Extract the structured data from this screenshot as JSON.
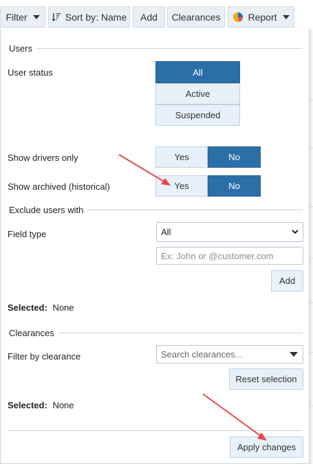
{
  "toolbar": {
    "filter": "Filter",
    "sort": "Sort by: Name",
    "add": "Add",
    "clearances": "Clearances",
    "report": "Report"
  },
  "users": {
    "legend": "Users",
    "status_label": "User status",
    "status_options": [
      "All",
      "Active",
      "Suspended"
    ],
    "status_selected": "All",
    "drivers_label": "Show drivers only",
    "drivers": {
      "yes": "Yes",
      "no": "No",
      "selected": "No"
    },
    "archived_label": "Show archived (historical)",
    "archived": {
      "yes": "Yes",
      "no": "No",
      "selected": "No"
    }
  },
  "exclude": {
    "legend": "Exclude users with",
    "field_type_label": "Field type",
    "field_type_value": "All",
    "value_placeholder": "Ex: John or @customer.com",
    "add_button": "Add",
    "selected_label": "Selected:",
    "selected_value": "None"
  },
  "clearances": {
    "legend": "Clearances",
    "filter_label": "Filter by clearance",
    "search_placeholder": "Search clearances...",
    "reset_button": "Reset selection",
    "selected_label": "Selected:",
    "selected_value": "None"
  },
  "footer": {
    "apply_button": "Apply changes"
  },
  "colors": {
    "accent": "#2b6fa8",
    "segment_off": "#e8f1fa",
    "annotation_arrow": "#e84646"
  }
}
